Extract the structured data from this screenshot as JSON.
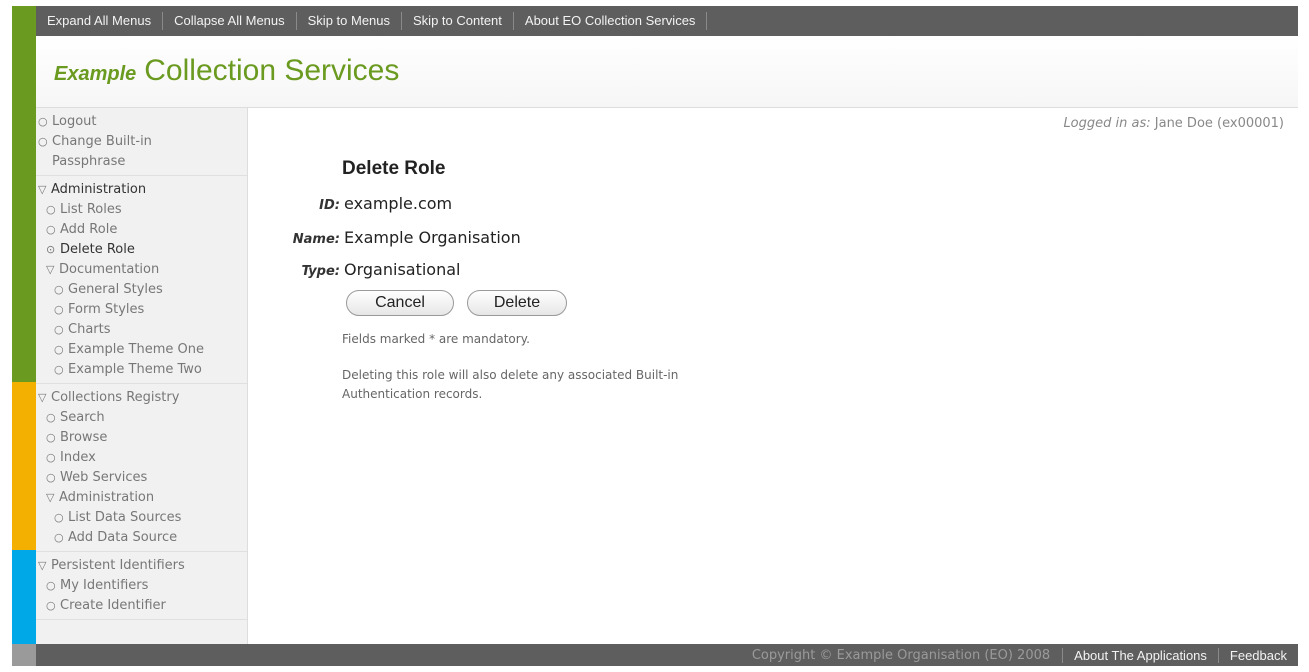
{
  "topnav": {
    "links": [
      "Expand All Menus",
      "Collapse All Menus",
      "Skip to Menus",
      "Skip to Content",
      "About EO Collection Services"
    ]
  },
  "banner": {
    "brand_prefix": "Example",
    "brand_title": "Collection Services"
  },
  "sidebar": {
    "account": [
      "Logout",
      "Change Built-in Passphrase"
    ],
    "administration": {
      "label": "Administration",
      "items": [
        "List Roles",
        "Add Role",
        "Delete Role"
      ],
      "documentation": {
        "label": "Documentation",
        "items": [
          "General Styles",
          "Form Styles",
          "Charts",
          "Example Theme One",
          "Example Theme Two"
        ]
      }
    },
    "registry": {
      "label": "Collections Registry",
      "items": [
        "Search",
        "Browse",
        "Index",
        "Web Services"
      ],
      "administration": {
        "label": "Administration",
        "items": [
          "List Data Sources",
          "Add Data Source"
        ]
      }
    },
    "identifiers": {
      "label": "Persistent Identifiers",
      "items": [
        "My Identifiers",
        "Create Identifier"
      ]
    }
  },
  "main": {
    "logged_in_label": "Logged in as:",
    "logged_in_user": "Jane Doe (ex00001)",
    "title": "Delete Role",
    "fields": [
      {
        "label": "ID:",
        "value": "example.com"
      },
      {
        "label": "Name:",
        "value": "Example Organisation"
      },
      {
        "label": "Type:",
        "value": "Organisational"
      }
    ],
    "cancel_label": "Cancel",
    "delete_label": "Delete",
    "mandatory_note": "Fields marked * are mandatory.",
    "warning_note": "Deleting this role will also delete any associated Built-in Authentication records."
  },
  "footer": {
    "copyright": "Copyright © Example Organisation (EO) 2008",
    "links": [
      "About The Applications",
      "Feedback"
    ]
  },
  "colors": {
    "green": "#6a9a1f",
    "orange": "#f4b000",
    "cyan": "#00a8e8",
    "grey": "#9a9a9a",
    "navbar": "#5e5e5e"
  }
}
